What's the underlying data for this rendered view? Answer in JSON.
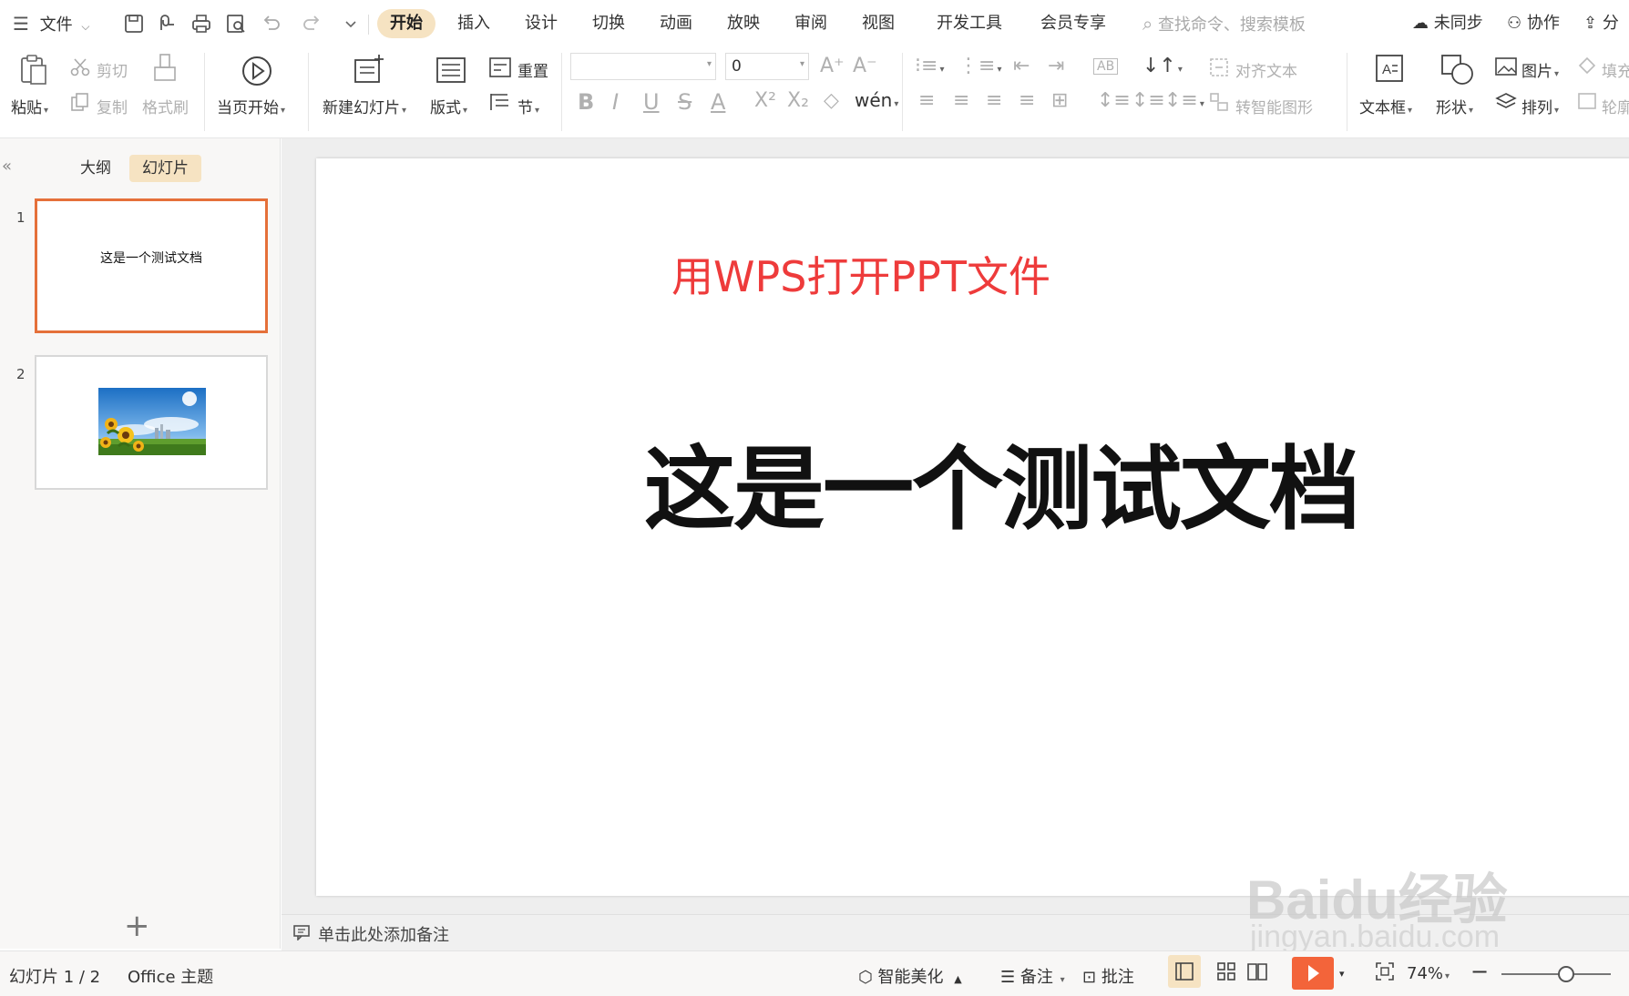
{
  "menubar": {
    "menu_label": "文件",
    "tabs": [
      {
        "label": "开始",
        "active": true
      },
      {
        "label": "插入"
      },
      {
        "label": "设计"
      },
      {
        "label": "切换"
      },
      {
        "label": "动画"
      },
      {
        "label": "放映"
      },
      {
        "label": "审阅"
      },
      {
        "label": "视图"
      },
      {
        "label": "开发工具"
      },
      {
        "label": "会员专享"
      }
    ],
    "search_placeholder": "查找命令、搜索模板",
    "sync_label": "未同步",
    "collab_label": "协作",
    "share_label": "分"
  },
  "ribbon": {
    "paste": "粘贴",
    "cut": "剪切",
    "copy": "复制",
    "format_painter": "格式刷",
    "play_from_current": "当页开始",
    "new_slide": "新建幻灯片",
    "layout": "版式",
    "reset": "重置",
    "section": "节",
    "font_size": "0",
    "align_text": "对齐文本",
    "smart_art": "转智能图形",
    "textbox": "文本框",
    "shape": "形状",
    "picture": "图片",
    "arrange": "排列",
    "fill": "填充",
    "outline": "轮廓"
  },
  "leftpanel": {
    "tab_outline": "大纲",
    "tab_slides": "幻灯片",
    "slides": [
      {
        "number": "1",
        "text": "这是一个测试文档"
      },
      {
        "number": "2"
      }
    ]
  },
  "slide": {
    "subtitle": "用WPS打开PPT文件",
    "title": "这是一个测试文档"
  },
  "notes": {
    "placeholder": "单击此处添加备注"
  },
  "watermark": {
    "main": "Baidu经验",
    "url": "jingyan.baidu.com"
  },
  "statusbar": {
    "slide_indicator": "幻灯片 1 / 2",
    "theme": "Office 主题",
    "beautify": "智能美化",
    "notes": "备注",
    "comments": "批注",
    "zoom": "74%"
  },
  "colors": {
    "accent": "#f6e3c2",
    "selection_border": "#e5703a",
    "subtitle_red": "#ee3b3b",
    "play": "#f3643a"
  }
}
